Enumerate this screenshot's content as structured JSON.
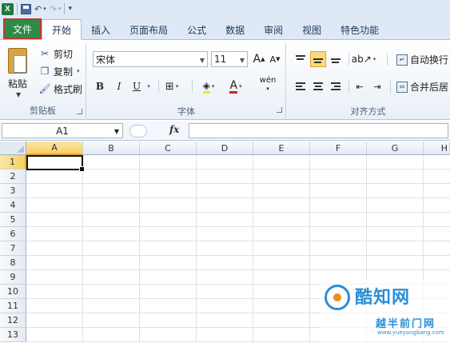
{
  "app": {
    "icon": "X"
  },
  "qat": {
    "save_icon": "save-icon",
    "undo_icon": "undo-icon",
    "redo_icon": "redo-icon"
  },
  "tabs": [
    {
      "label": "文件"
    },
    {
      "label": "开始"
    },
    {
      "label": "插入"
    },
    {
      "label": "页面布局"
    },
    {
      "label": "公式"
    },
    {
      "label": "数据"
    },
    {
      "label": "审阅"
    },
    {
      "label": "视图"
    },
    {
      "label": "特色功能"
    }
  ],
  "clipboard": {
    "group_label": "剪贴板",
    "paste": "粘贴",
    "cut": "剪切",
    "copy": "复制",
    "format_painter": "格式刷"
  },
  "font": {
    "group_label": "字体",
    "font_name": "宋体",
    "font_size": "11",
    "grow": "A",
    "shrink": "A",
    "bold": "B",
    "italic": "I",
    "underline": "U",
    "font_color": "A",
    "phonetic": "wén"
  },
  "alignment": {
    "group_label": "对齐方式",
    "wrap_text": "自动换行",
    "merge_center": "合并后居"
  },
  "formula_bar": {
    "name_box": "A1",
    "fx": "fx",
    "value": ""
  },
  "sheet": {
    "columns": [
      "A",
      "B",
      "C",
      "D",
      "E",
      "F",
      "G",
      "H"
    ],
    "rows": [
      "1",
      "2",
      "3",
      "4",
      "5",
      "6",
      "7",
      "8",
      "9",
      "10",
      "11",
      "12",
      "13"
    ],
    "active_cell": "A1"
  },
  "watermark": {
    "title": "酷知网",
    "subtitle": "越半前门网",
    "url": "www.yueyangbang.com"
  },
  "colors": {
    "file_tab": "#2e8b47",
    "accent": "#fbd97c",
    "highlight_box": "#c0392b"
  }
}
